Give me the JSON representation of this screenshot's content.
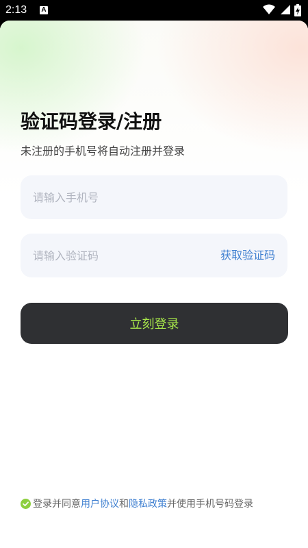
{
  "status_bar": {
    "time": "2:13",
    "notification_icon": "a-icon",
    "icons": [
      "wifi-icon",
      "signal-icon",
      "battery-charging-icon"
    ]
  },
  "login": {
    "title": "验证码登录/注册",
    "subtitle": "未注册的手机号将自动注册并登录",
    "phone_placeholder": "请输入手机号",
    "code_placeholder": "请输入验证码",
    "get_code_label": "获取验证码",
    "submit_label": "立刻登录"
  },
  "agreement": {
    "prefix": "登录并同意",
    "user_agreement": "用户协议",
    "and": "和",
    "privacy_policy": "隐私政策",
    "suffix": "并使用手机号码登录",
    "checked": true
  },
  "colors": {
    "accent": "#3e7fd0",
    "button_bg": "#2f3033",
    "button_text": "#a8e84a",
    "check": "#8dcf3f",
    "field_bg": "#f4f6fb"
  }
}
